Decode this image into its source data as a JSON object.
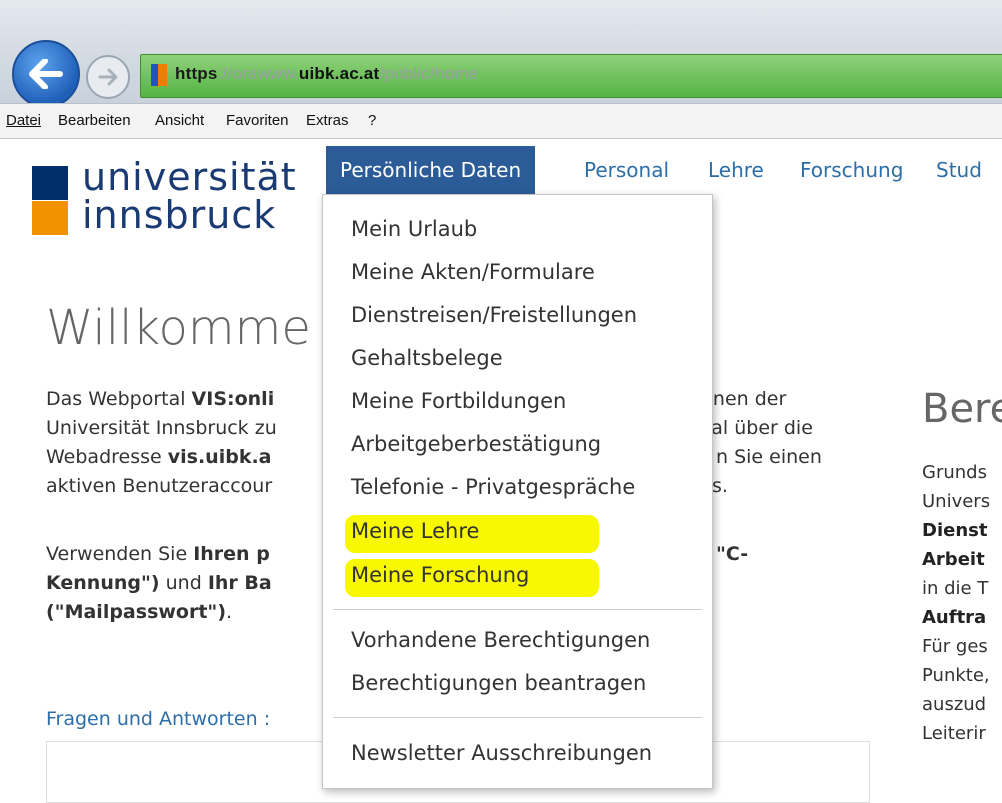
{
  "browser": {
    "url_protocol": "https",
    "url_pre": "://orawww.",
    "url_domain": "uibk.ac.at",
    "url_path": "/public/home",
    "menu": [
      "Datei",
      "Bearbeiten",
      "Ansicht",
      "Favoriten",
      "Extras",
      "?"
    ]
  },
  "logo": {
    "line1": "universität",
    "line2": "innsbruck"
  },
  "nav": {
    "active": "Persönliche Daten",
    "items": [
      "Personal",
      "Lehre",
      "Forschung",
      "Stud"
    ]
  },
  "dropdown": {
    "items": [
      "Mein Urlaub",
      "Meine Akten/Formulare",
      "Dienstreisen/Freistellungen",
      "Gehaltsbelege",
      "Meine Fortbildungen",
      "Arbeitgeberbestätigung",
      "Telefonie - Privatgespräche",
      "Meine Lehre",
      "Meine Forschung",
      "Vorhandene Berechtigungen",
      "Berechtigungen beantragen",
      "Newsletter Ausschreibungen"
    ],
    "highlight_color": "#f8f800"
  },
  "main": {
    "title": "Willkomme",
    "p1": [
      {
        "a": "Das Webportal ",
        "b": "VIS:onli",
        "c": "",
        "r": "ionen der"
      },
      {
        "a": "Universität Innsbruck zu",
        "b": "",
        "c": "",
        "r": "rtal über die"
      },
      {
        "a": "Webadresse ",
        "b": "vis.uibk.a",
        "c": "",
        "r": "n Sie einen"
      },
      {
        "a": "aktiven Benutzeraccour",
        "b": "",
        "c": "",
        "r": "s."
      }
    ],
    "p2": [
      {
        "a": "Verwenden Sie ",
        "b": "Ihren p",
        "c": "",
        "r": "\"C-"
      },
      {
        "a": "",
        "b": "Kennung\")",
        "c": " und ",
        "d": "Ihr Ba",
        "r": ""
      },
      {
        "a": "",
        "b": "(\"Mailpasswort\")",
        "c": ".",
        "r": ""
      }
    ],
    "faq": "Fragen und Antworten :"
  },
  "right": {
    "heading": "Bere",
    "lines": [
      "Grunds",
      "Univers",
      "Dienst",
      "Arbeit",
      "in die T",
      "Auftra",
      "Für ges",
      "Punkte,",
      "auszud",
      "Leiterir"
    ]
  },
  "colors": {
    "nav_active_bg": "#2b5c97",
    "link": "#2d6ea8",
    "logo_blue": "#002f6c",
    "logo_orange": "#f39200"
  }
}
